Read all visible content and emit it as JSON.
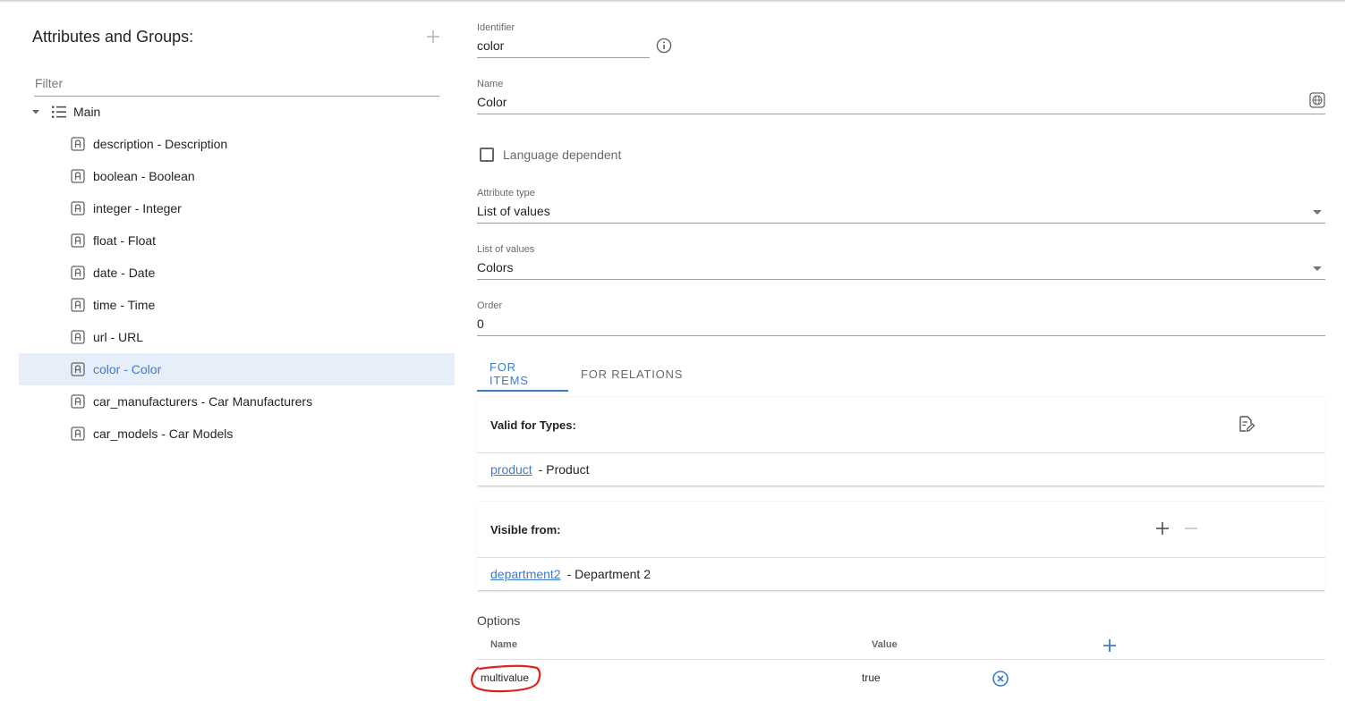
{
  "colors": {
    "accent": "#3d7cc9",
    "selected_bg": "#e6eef9",
    "annotation": "#d9251d"
  },
  "left": {
    "title": "Attributes and Groups:",
    "add_icon": "plus-icon",
    "filter_placeholder": "Filter",
    "root": {
      "label": "Main",
      "icon": "list-icon",
      "expanded": true
    },
    "items": [
      {
        "label": "description - Description"
      },
      {
        "label": "boolean - Boolean"
      },
      {
        "label": "integer - Integer"
      },
      {
        "label": "float - Float"
      },
      {
        "label": "date - Date"
      },
      {
        "label": "time - Time"
      },
      {
        "label": "url - URL"
      },
      {
        "label": "color - Color",
        "selected": true
      },
      {
        "label": "car_manufacturers - Car Manufacturers"
      },
      {
        "label": "car_models - Car Models"
      }
    ]
  },
  "form": {
    "identifier": {
      "label": "Identifier",
      "value": "color"
    },
    "name": {
      "label": "Name",
      "value": "Color"
    },
    "language_dependent": {
      "label": "Language dependent",
      "checked": false
    },
    "attribute_type": {
      "label": "Attribute type",
      "value": "List of values"
    },
    "list_of_values": {
      "label": "List of values",
      "value": "Colors"
    },
    "order": {
      "label": "Order",
      "value": "0"
    }
  },
  "tabs": [
    {
      "label": "FOR ITEMS",
      "active": true
    },
    {
      "label": "FOR RELATIONS",
      "active": false
    }
  ],
  "valid_for_types": {
    "title": "Valid for Types:",
    "rows": [
      {
        "link": "product",
        "text": "- Product"
      }
    ]
  },
  "visible_from": {
    "title": "Visible from:",
    "rows": [
      {
        "link": "department2",
        "text": "- Department 2"
      }
    ]
  },
  "options": {
    "title": "Options",
    "col_name": "Name",
    "col_value": "Value",
    "rows": [
      {
        "name": "multivalue",
        "value": "true"
      }
    ]
  }
}
